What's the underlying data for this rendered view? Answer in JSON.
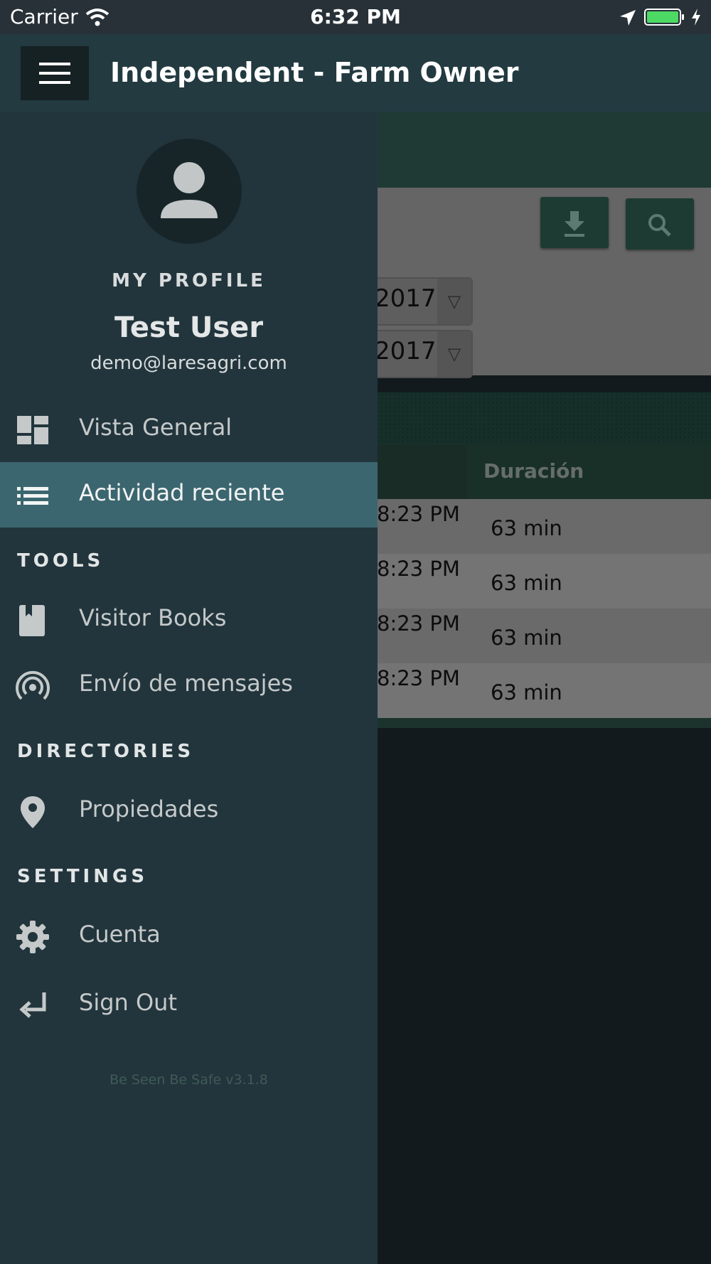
{
  "status_bar": {
    "carrier": "Carrier",
    "time": "6:32 PM"
  },
  "header": {
    "title": "Independent - Farm Owner"
  },
  "background": {
    "date_selects": [
      "2017",
      "2017"
    ],
    "table": {
      "duration_header": "Duración",
      "rows": [
        {
          "time": "8:23 PM",
          "duration": "63 min"
        },
        {
          "time": "8:23 PM",
          "duration": "63 min"
        },
        {
          "time": "8:23 PM",
          "duration": "63 min"
        },
        {
          "time": "8:23 PM",
          "duration": "63 min"
        }
      ]
    }
  },
  "drawer": {
    "profile_label": "MY PROFILE",
    "user_name": "Test User",
    "user_email": "demo@laresagri.com",
    "items": {
      "overview": "Vista General",
      "recent_activity": "Actividad reciente",
      "visitor_books": "Visitor Books",
      "messaging": "Envío de mensajes",
      "properties": "Propiedades",
      "account": "Cuenta",
      "sign_out": "Sign Out"
    },
    "sections": {
      "tools": "TOOLS",
      "directories": "DIRECTORIES",
      "settings": "SETTINGS"
    },
    "version": "Be Seen Be Safe v3.1.8"
  },
  "colors": {
    "drawer_bg": "#22353c",
    "active_item": "#3c666f",
    "header_bg": "#223a40"
  }
}
